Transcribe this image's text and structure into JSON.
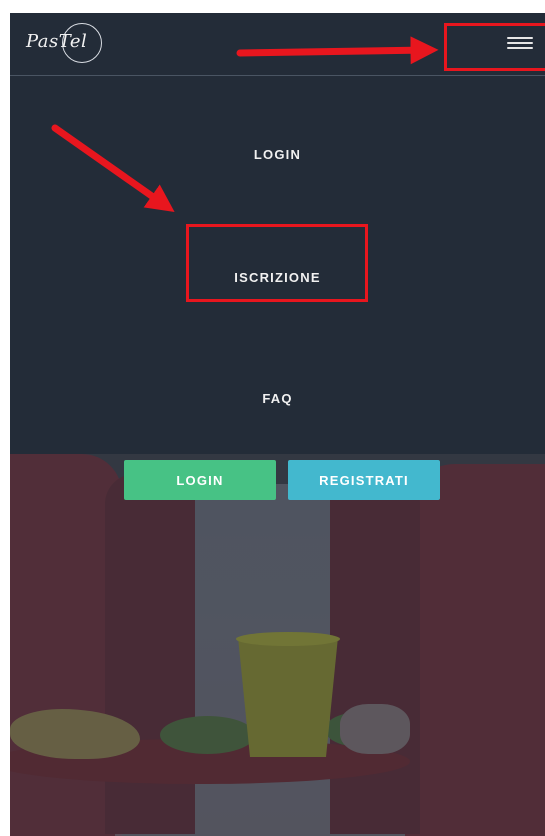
{
  "header": {
    "logo_text": "PasTel",
    "menu_icon": "hamburger-menu-icon"
  },
  "nav_menu": {
    "items": [
      {
        "label": "LOGIN"
      },
      {
        "label": "ISCRIZIONE"
      },
      {
        "label": "FAQ"
      }
    ]
  },
  "hero": {
    "login_label": "LOGIN",
    "register_label": "REGISTRATI"
  },
  "colors": {
    "background": "#232c38",
    "login_button": "#47c285",
    "register_button": "#43b8ce",
    "annotation": "#e8161e"
  }
}
